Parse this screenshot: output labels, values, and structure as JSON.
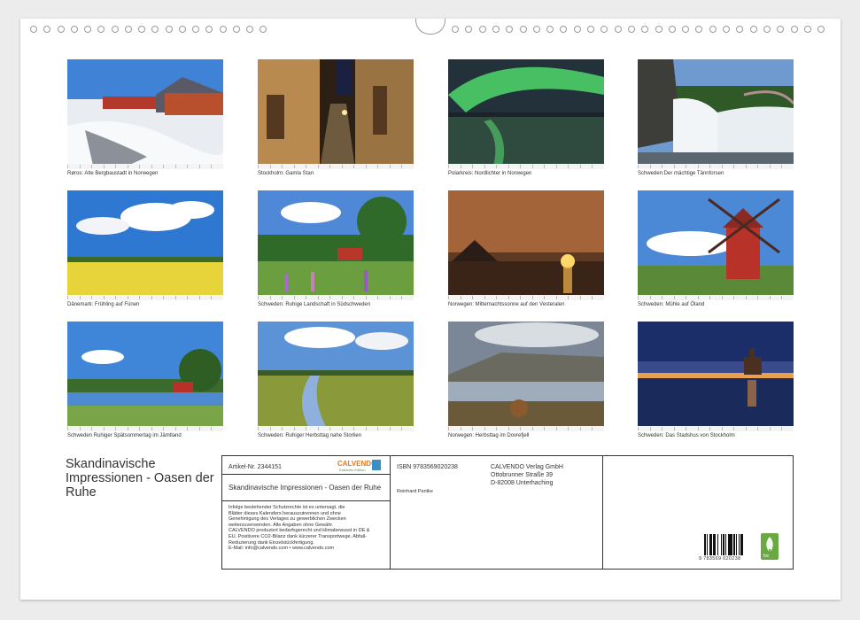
{
  "photos": [
    {
      "caption": "Røros: Alte Bergbaustadt in Norwegen",
      "scene": "snow-town"
    },
    {
      "caption": "Stockholm: Gamla Stan",
      "scene": "old-street"
    },
    {
      "caption": "Polarkreis: Nordlichter in Norwegen",
      "scene": "aurora"
    },
    {
      "caption": "Schweden:Der mächtige Tännforsen",
      "scene": "waterfall"
    },
    {
      "caption": "Dänemark: Frühling auf Fünen",
      "scene": "rapeseed"
    },
    {
      "caption": "Schweden: Ruhige Landschaft in Südschweden",
      "scene": "lupins"
    },
    {
      "caption": "Norwegen: Mitternachtssonne auf den Vesteralen",
      "scene": "midnight-sun"
    },
    {
      "caption": "Schweden: Mühle auf Öland",
      "scene": "windmill"
    },
    {
      "caption": "Schweden Ruhiger Spätsommertag im Jämtland",
      "scene": "lake-house"
    },
    {
      "caption": "Schweden: Ruhiger Herbsttag nahe Storlien",
      "scene": "river-meadow"
    },
    {
      "caption": "Norwegen: Herbsttag im Dovrefjell",
      "scene": "dovrefjell"
    },
    {
      "caption": "Schweden: Das Stadshus von Stockholm",
      "scene": "stadshus"
    }
  ],
  "title": "Skandinavische Impressionen - Oasen der Ruhe",
  "info": {
    "article": "Artikel-Nr. 2344151",
    "logo": "CALVENDO",
    "logo_sub": "Kalender-Edition",
    "subtitle": "Skandinavische Impressionen - Oasen der Ruhe",
    "legal": [
      "Infolge bestehender Schutzrechte ist es untersagt, die",
      "Blätter dieses Kalenders herauszutrennen und ohne",
      "Genehmigung des Verlages zu gewerblichen Zwecken",
      "weiterzuverwenden. Alle Angaben ohne Gewähr.",
      "CALVENDO produziert bedarfsgerecht und klimabewusst in DE &",
      "EU. Positivere CO2-Bilanz dank kürzerer Transportwege. Abfall-",
      "Reduzierung dank Einzelstückfertigung.",
      "E-Mail: info@calvendo.com • www.calvendo.com"
    ],
    "isbn": "ISBN 9783569020238",
    "author": "Reinhard Pantke",
    "publisher": [
      "CALVENDO Verlag GmbH",
      "Ottobrunner Straße 39",
      "D-82008 Unterhaching"
    ],
    "barcode_number": "9 783569 020238",
    "fsc_label": "fsc"
  }
}
